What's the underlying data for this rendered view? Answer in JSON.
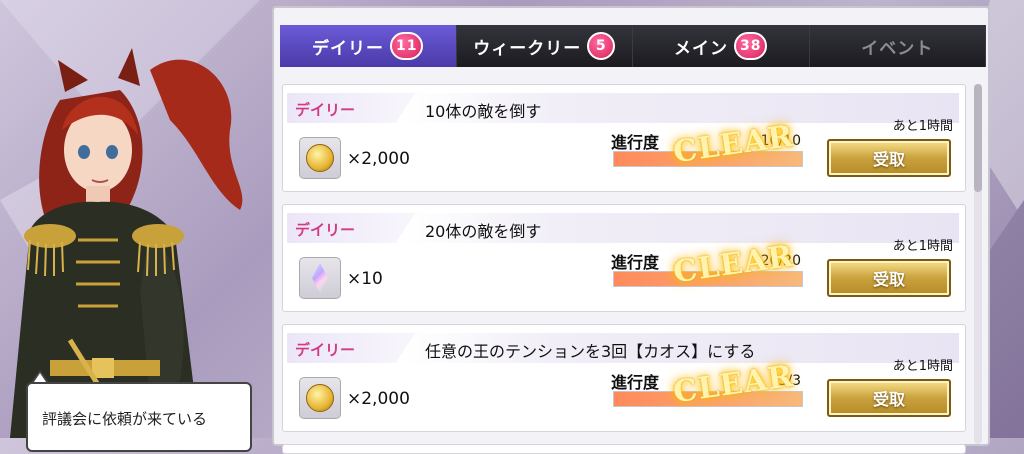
{
  "tabs": [
    {
      "label": "デイリー",
      "badge": "11",
      "state": "active"
    },
    {
      "label": "ウィークリー",
      "badge": "5",
      "state": "normal"
    },
    {
      "label": "メイン",
      "badge": "38",
      "state": "normal"
    },
    {
      "label": "イベント",
      "badge": "",
      "state": "disabled"
    }
  ],
  "missions": [
    {
      "category": "デイリー",
      "title": "10体の敵を倒す",
      "remaining": "あと1時間",
      "reward_icon": "gold-coin-icon",
      "amount": "×2,000",
      "progress_label": "進行度",
      "progress_text": "10/10",
      "progress": 1.0,
      "status": "CLEAR",
      "claim_label": "受取"
    },
    {
      "category": "デイリー",
      "title": "20体の敵を倒す",
      "remaining": "あと1時間",
      "reward_icon": "gem-icon",
      "amount": "×10",
      "progress_label": "進行度",
      "progress_text": "20/20",
      "progress": 1.0,
      "status": "CLEAR",
      "claim_label": "受取"
    },
    {
      "category": "デイリー",
      "title": "任意の王のテンションを3回【カオス】にする",
      "remaining": "あと1時間",
      "reward_icon": "gold-coin-icon",
      "amount": "×2,000",
      "progress_label": "進行度",
      "progress_text": "3/3",
      "progress": 1.0,
      "status": "CLEAR",
      "claim_label": "受取"
    }
  ],
  "dialog": {
    "text": "評議会に依頼が来ている"
  },
  "colors": {
    "accent_tab": "#5a48c4",
    "badge": "#e0306a",
    "category_text": "#d13a84",
    "claim_button": "#caa23e"
  }
}
